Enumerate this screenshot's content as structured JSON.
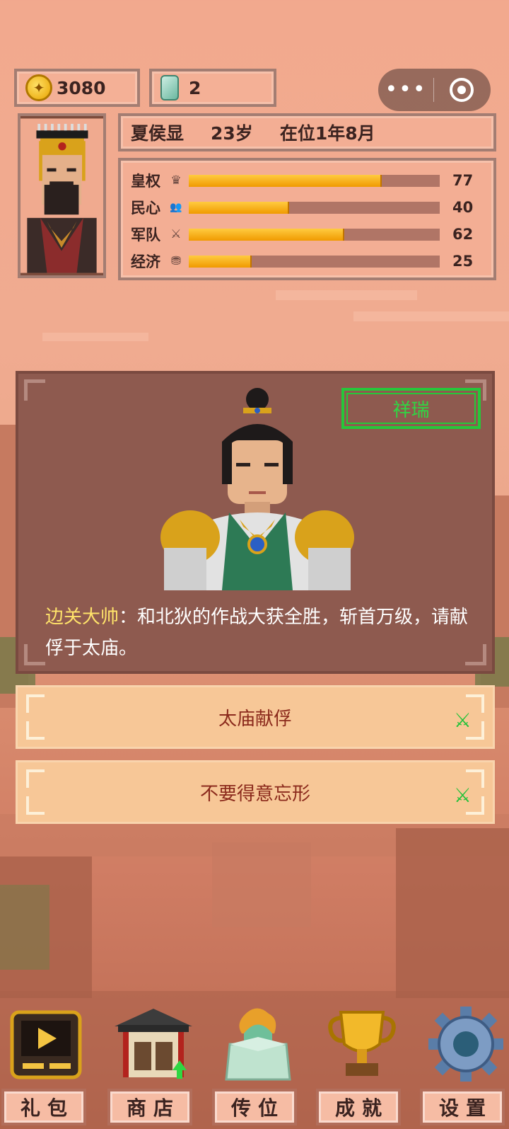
{
  "currency": {
    "coins": "3080",
    "jade": "2",
    "coin_icon": "gold-coin-icon",
    "jade_icon": "jade-gem-icon"
  },
  "capsule": {
    "more_label": "•••",
    "close_icon": "target-close-icon"
  },
  "ruler": {
    "name": "夏侯显",
    "age": "23岁",
    "reign": "在位1年8月"
  },
  "stats": [
    {
      "name": "皇权",
      "icon": "crown-icon",
      "glyph": "♛",
      "value": 77
    },
    {
      "name": "民心",
      "icon": "people-icon",
      "glyph": "👥",
      "value": 40
    },
    {
      "name": "军队",
      "icon": "crossed-swords-icon",
      "glyph": "⚔",
      "value": 62
    },
    {
      "name": "经济",
      "icon": "coins-stack-icon",
      "glyph": "⛃",
      "value": 25
    }
  ],
  "stat_max": 100,
  "event": {
    "omen_tag": "祥瑞",
    "speaker": "边关大帅",
    "text": "：和北狄的作战大获全胜，斩首万级，请献俘于太庙。"
  },
  "choices": [
    {
      "label": "太庙献俘",
      "effect_icon": "crossed-swords-icon",
      "effect_glyph": "⚔"
    },
    {
      "label": "不要得意忘形",
      "effect_icon": "crossed-swords-icon",
      "effect_glyph": "⚔"
    }
  ],
  "nav": [
    {
      "label": "礼包",
      "icon": "video-play-icon"
    },
    {
      "label": "商店",
      "icon": "shop-building-icon"
    },
    {
      "label": "传位",
      "icon": "jade-seal-icon",
      "seal_text": "传国玉玺"
    },
    {
      "label": "成就",
      "icon": "trophy-icon"
    },
    {
      "label": "设置",
      "icon": "gear-icon"
    }
  ],
  "colors": {
    "accent_gold": "#f09a00",
    "omen_green": "#26c73a",
    "speaker_yellow": "#ffe36a",
    "choice_text": "#8b2a1c"
  }
}
